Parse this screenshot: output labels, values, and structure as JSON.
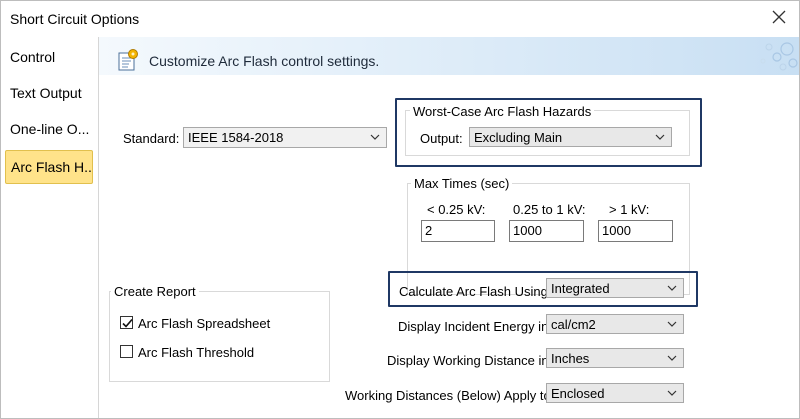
{
  "window": {
    "title": "Short Circuit Options"
  },
  "sidebar": {
    "items": [
      {
        "label": "Control"
      },
      {
        "label": "Text Output"
      },
      {
        "label": "One-line O..."
      },
      {
        "label": "Arc Flash H..."
      }
    ],
    "active_index": 3
  },
  "header": {
    "text": "Customize Arc Flash control settings."
  },
  "standard": {
    "label": "Standard:",
    "value": "IEEE 1584-2018"
  },
  "worst_case": {
    "title": "Worst-Case Arc Flash Hazards",
    "output_label": "Output:",
    "output_value": "Excluding Main"
  },
  "max_times": {
    "title": "Max Times (sec)",
    "columns": [
      {
        "label": "< 0.25 kV:",
        "value": "2"
      },
      {
        "label": "0.25 to 1 kV:",
        "value": "1000"
      },
      {
        "label": "> 1 kV:",
        "value": "1000"
      }
    ]
  },
  "create_report": {
    "title": "Create Report",
    "items": [
      {
        "label": "Arc Flash Spreadsheet",
        "checked": true
      },
      {
        "label": "Arc Flash Threshold",
        "checked": false
      }
    ]
  },
  "settings": [
    {
      "label": "Calculate Arc Flash Using:",
      "value": "Integrated"
    },
    {
      "label": "Display Incident Energy in:",
      "value": "cal/cm2"
    },
    {
      "label": "Display Working Distance in:",
      "value": "Inches"
    },
    {
      "label": "Working Distances (Below) Apply to:",
      "value": "Enclosed"
    }
  ],
  "colors": {
    "highlight_border": "#1f3864",
    "active_sidebar": "#ffe38a",
    "header_band": "#dcebf8"
  },
  "icons": [
    "close-icon",
    "settings-document-icon",
    "dropdown-arrow-icon",
    "checkmark-icon"
  ]
}
